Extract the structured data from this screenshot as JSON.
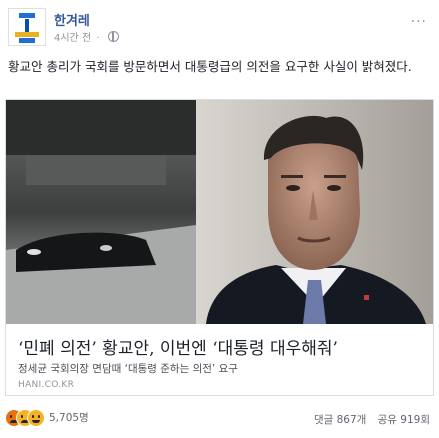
{
  "page": {
    "name": "한겨레",
    "timestamp": "4시간 전",
    "privacy_icon": "globe-icon",
    "menu_icon": "more-icon"
  },
  "post": {
    "text": "황교안 총리가 국회를 방문하면서 대통령급의 의전을 요구한 사실이 밝혀졌다."
  },
  "link": {
    "headline": "‘민폐 의전’ 황교안, 이번엔 ‘대통령 대우해줘’",
    "description": "정세균 국회의장 면담때 ‘대통령 준하는 의전’ 요구",
    "domain": "HANI.CO.KR"
  },
  "stats": {
    "reactions": [
      "angry-icon",
      "sad-icon",
      "haha-icon"
    ],
    "reaction_count": "5,705명",
    "comments": "댓글 867개",
    "shares": "공유 919회"
  },
  "colors": {
    "page_name": "#365899",
    "meta": "#90949c",
    "angry": "#e9710f",
    "sad_haha": "#f7b125",
    "logo_blue": "#1f6fd6",
    "logo_yellow": "#e8b321"
  }
}
